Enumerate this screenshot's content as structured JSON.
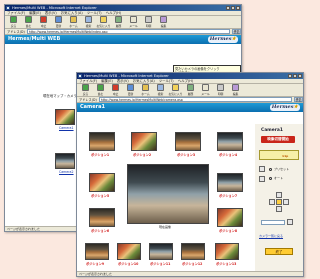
{
  "back_window": {
    "title": "Hermes/Multi WEB - Microsoft Internet Explorer",
    "menu": [
      "ファイル(F)",
      "編集(E)",
      "表示(V)",
      "お気に入り(A)",
      "ツール(T)",
      "ヘルプ(H)"
    ],
    "toolbar": [
      "戻る",
      "進む",
      "中止",
      "更新",
      "ホーム",
      "検索",
      "お気に入り",
      "履歴",
      "メール",
      "印刷",
      "編集"
    ],
    "address_label": "アドレス(D)",
    "address": "http://www.hermes.jp/HermesMultiWeb/index.asp",
    "go_label": "移動",
    "banner_title": "Hermes/Multi WEB",
    "logo_text": "Hermes",
    "tooltip_lines": [
      "見たいカメラの画像をクリック",
      "して下さい。"
    ],
    "side_label": "現在地マップ・カメラ",
    "camera_labels": [
      "Camera1",
      "Camera2"
    ],
    "status": "ページが表示されました"
  },
  "front_window": {
    "title": "Hermes/Multi WEB - Microsoft Internet Explorer",
    "menu": [
      "ファイル(F)",
      "編集(E)",
      "表示(V)",
      "お気に入り(A)",
      "ツール(T)",
      "ヘルプ(H)"
    ],
    "toolbar": [
      "戻る",
      "進む",
      "中止",
      "更新",
      "ホーム",
      "検索",
      "お気に入り",
      "履歴",
      "メール",
      "印刷",
      "編集"
    ],
    "address_label": "アドレス(D)",
    "address": "http://www.hermes.jp/HermesMultiWeb/camera.asp",
    "go_label": "移動",
    "banner_title": "Camera1",
    "logo_text": "Hermes",
    "grid_captions": {
      "top": [
        "ポジション1",
        "ポジション2",
        "ポジション3",
        "ポジション4"
      ],
      "left": [
        "ポジション5",
        "ポジション6"
      ],
      "right": [
        "ポジション7",
        "ポジション8"
      ],
      "bottom": [
        "ポジション9",
        "ポジション10",
        "ポジション11",
        "ポジション12",
        "ポジション13"
      ]
    },
    "main_caption": "現在画像",
    "panel": {
      "camera_label": "Camera1",
      "live_button": "映像切替開始",
      "zoom_label": "11p",
      "radio_1": "プリセット",
      "radio_2": "オート",
      "link_1": "カメラ一覧に戻る",
      "ok_button": "終了"
    },
    "status": "ページが表示されました"
  },
  "colors": {
    "banner": "#1e9ad6",
    "accent_red": "#c9251a",
    "page_bg": "#fbe8df"
  }
}
